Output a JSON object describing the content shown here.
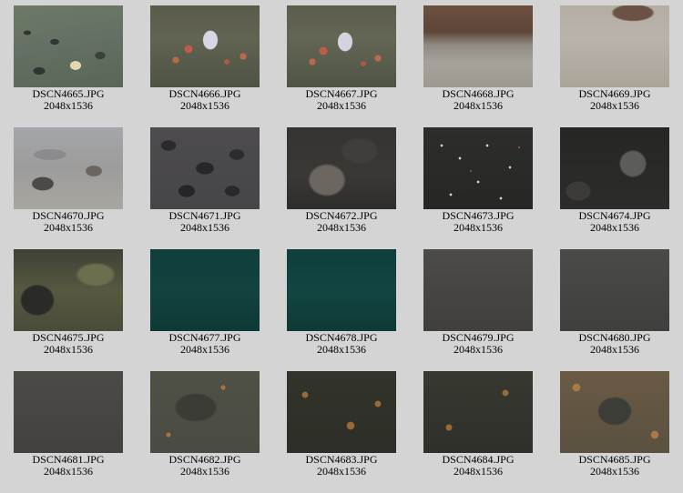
{
  "gallery": {
    "items": [
      {
        "filename": "DSCN4665.JPG",
        "dimensions": "2048x1536"
      },
      {
        "filename": "DSCN4666.JPG",
        "dimensions": "2048x1536"
      },
      {
        "filename": "DSCN4667.JPG",
        "dimensions": "2048x1536"
      },
      {
        "filename": "DSCN4668.JPG",
        "dimensions": "2048x1536"
      },
      {
        "filename": "DSCN4669.JPG",
        "dimensions": "2048x1536"
      },
      {
        "filename": "DSCN4670.JPG",
        "dimensions": "2048x1536"
      },
      {
        "filename": "DSCN4671.JPG",
        "dimensions": "2048x1536"
      },
      {
        "filename": "DSCN4672.JPG",
        "dimensions": "2048x1536"
      },
      {
        "filename": "DSCN4673.JPG",
        "dimensions": "2048x1536"
      },
      {
        "filename": "DSCN4674.JPG",
        "dimensions": "2048x1536"
      },
      {
        "filename": "DSCN4675.JPG",
        "dimensions": "2048x1536"
      },
      {
        "filename": "DSCN4677.JPG",
        "dimensions": "2048x1536"
      },
      {
        "filename": "DSCN4678.JPG",
        "dimensions": "2048x1536"
      },
      {
        "filename": "DSCN4679.JPG",
        "dimensions": "2048x1536"
      },
      {
        "filename": "DSCN4680.JPG",
        "dimensions": "2048x1536"
      },
      {
        "filename": "DSCN4681.JPG",
        "dimensions": "2048x1536"
      },
      {
        "filename": "DSCN4682.JPG",
        "dimensions": "2048x1536"
      },
      {
        "filename": "DSCN4683.JPG",
        "dimensions": "2048x1536"
      },
      {
        "filename": "DSCN4684.JPG",
        "dimensions": "2048x1536"
      },
      {
        "filename": "DSCN4685.JPG",
        "dimensions": "2048x1536"
      }
    ]
  },
  "colors": {
    "page_background": "#d4d4d4",
    "caption_text": "#000000"
  }
}
